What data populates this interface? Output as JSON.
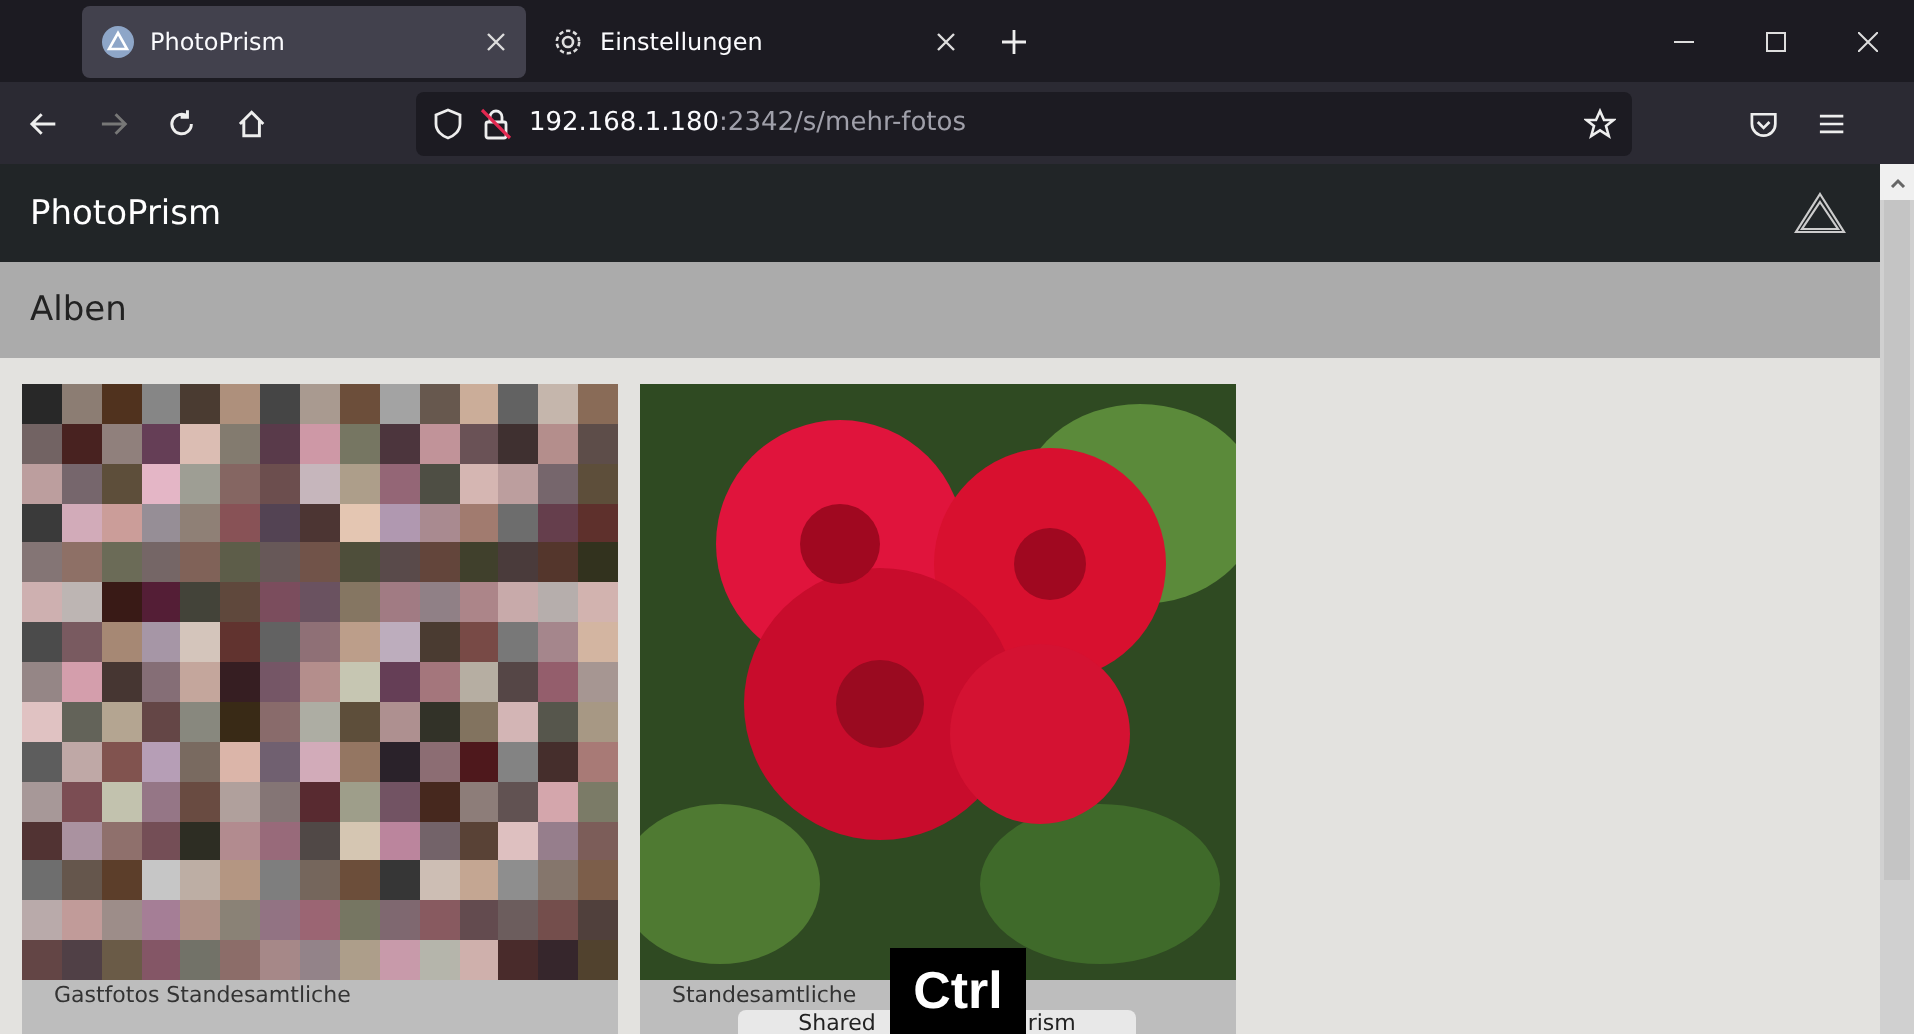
{
  "browser": {
    "tabs": [
      {
        "title": "PhotoPrism",
        "selected": true
      },
      {
        "title": "Einstellungen",
        "selected": false
      }
    ],
    "url_host": "192.168.1.180",
    "url_rest": ":2342/s/mehr-fotos"
  },
  "app": {
    "title": "PhotoPrism"
  },
  "page": {
    "title": "Alben"
  },
  "albums": [
    {
      "caption": "Gastfotos Standesamtliche"
    },
    {
      "caption": "Standesamtliche"
    }
  ],
  "toast": {
    "text_start": "Shared",
    "text_end": "rism"
  },
  "key_overlay": "Ctrl"
}
